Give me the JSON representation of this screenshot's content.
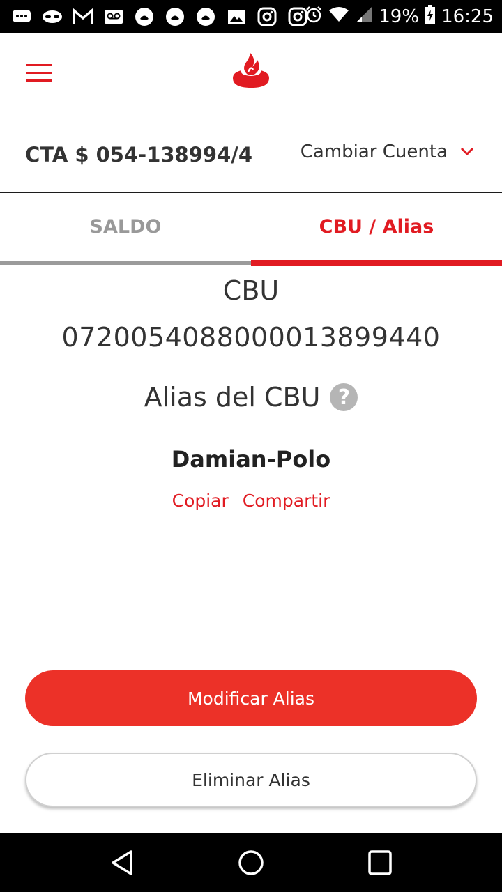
{
  "status_bar": {
    "battery": "19%",
    "time": "16:25",
    "left_icons": [
      "chat-icon",
      "incognito-icon",
      "gmail-icon",
      "voicemail-icon",
      "santander-notification-icon",
      "santander-notification-icon",
      "santander-notification-icon",
      "image-icon",
      "instagram-icon",
      "instagram-icon"
    ],
    "right_icons": [
      "alarm-icon",
      "wifi-icon",
      "signal-icon",
      "battery-charging-icon"
    ]
  },
  "header": {
    "menu_icon": "hamburger-menu-icon",
    "logo_icon": "santander-flame-logo",
    "brand_color": "#e11b22"
  },
  "account": {
    "label": "CTA $ 054-138994/4",
    "change_label": "Cambiar Cuenta",
    "change_icon": "chevron-down-icon"
  },
  "tabs": [
    {
      "label": "SALDO",
      "active": false
    },
    {
      "label": "CBU / Alias",
      "active": true
    }
  ],
  "cbu": {
    "title": "CBU",
    "number": "0720054088000013899440",
    "alias_label": "Alias del CBU",
    "help_icon": "question-circle-icon",
    "help_glyph": "?",
    "alias_value": "Damian-Polo",
    "copy_label": "Copiar",
    "share_label": "Compartir"
  },
  "actions": {
    "modify_label": "Modificar Alias",
    "delete_label": "Eliminar Alias",
    "primary_color": "#ec3128"
  },
  "nav_bar": {
    "icons": [
      "back-triangle-icon",
      "home-circle-icon",
      "recents-square-icon"
    ]
  }
}
